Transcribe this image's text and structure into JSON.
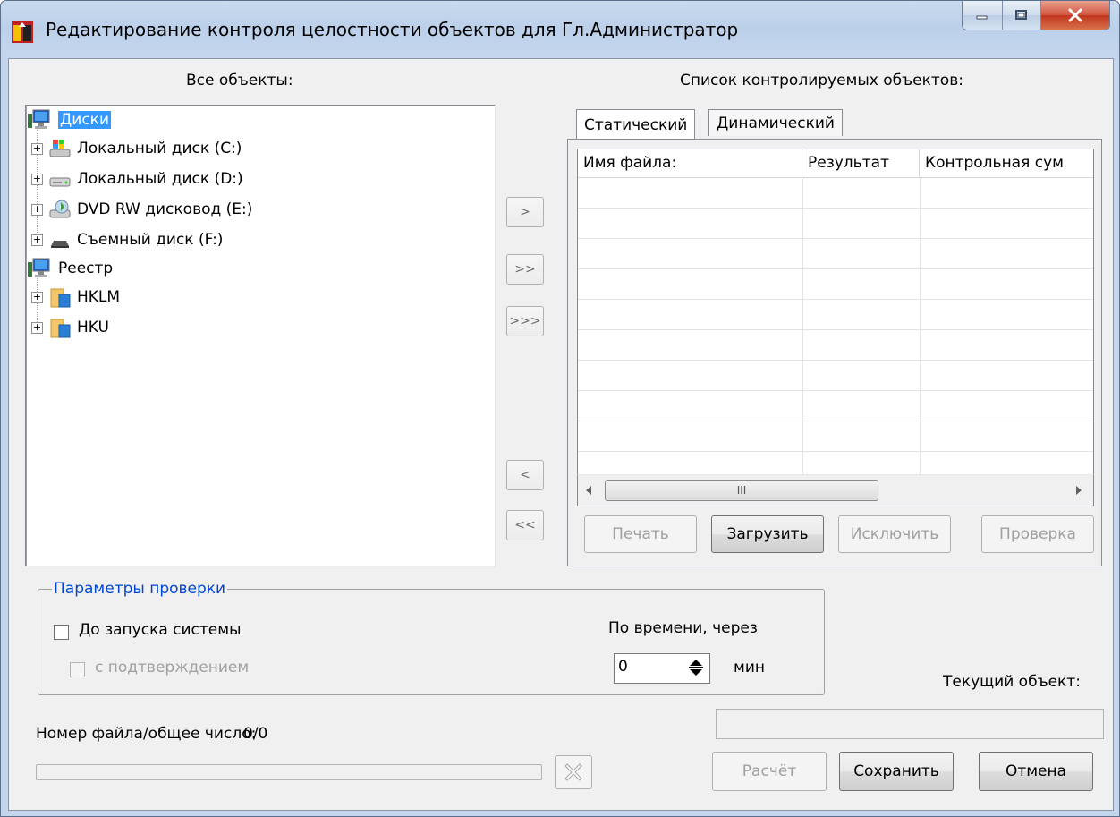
{
  "window": {
    "title": "Редактирование контроля целостности объектов для Гл.Администратор",
    "min_icon": "minimize-icon",
    "max_icon": "maximize-icon",
    "close_icon": "close-icon",
    "colors": {
      "titlebar": "#c9daee",
      "close": "#c0351d",
      "selection": "#3399ff",
      "group_title": "#0046d5"
    }
  },
  "left": {
    "heading": "Все объекты:",
    "tree": [
      {
        "label": "Диски",
        "icon": "computer-icon",
        "selected": true
      },
      {
        "label": "Локальный диск (C:)",
        "icon": "system-drive-icon"
      },
      {
        "label": "Локальный диск (D:)",
        "icon": "hard-drive-icon"
      },
      {
        "label": "DVD RW дисковод (E:)",
        "icon": "dvd-drive-icon"
      },
      {
        "label": "Съемный диск (F:)",
        "icon": "removable-drive-icon"
      },
      {
        "label": "Реестр",
        "icon": "computer-icon"
      },
      {
        "label": "HKLM",
        "icon": "registry-folder-icon"
      },
      {
        "label": "HKU",
        "icon": "registry-folder-icon"
      }
    ]
  },
  "transfer": {
    "add": ">",
    "add_all": ">>",
    "add_recursive": ">>>",
    "remove": "<",
    "remove_all": "<<"
  },
  "right": {
    "heading": "Список контролируемых объектов:",
    "tabs": [
      "Статический",
      "Динамический"
    ],
    "active_tab": "Статический",
    "columns": [
      "Имя файла:",
      "Результат",
      "Контрольная сум"
    ],
    "scroll_grip": "III",
    "buttons": {
      "print": "Печать",
      "load": "Загрузить",
      "exclude": "Исключить",
      "check": "Проверка"
    }
  },
  "params": {
    "title": "Параметры проверки",
    "before_start": "До запуска системы",
    "with_confirm": "с подтверждением",
    "by_time": "По времени, через",
    "interval_value": "0",
    "unit": "мин"
  },
  "status": {
    "current_object": "Текущий объект:",
    "file_counter_label": "Номер файла/общее число:",
    "file_counter_value": "0/0",
    "progress": 0
  },
  "footer": {
    "calc": "Расчёт",
    "save": "Сохранить",
    "cancel": "Отмена",
    "stop_icon": "stop-icon"
  }
}
